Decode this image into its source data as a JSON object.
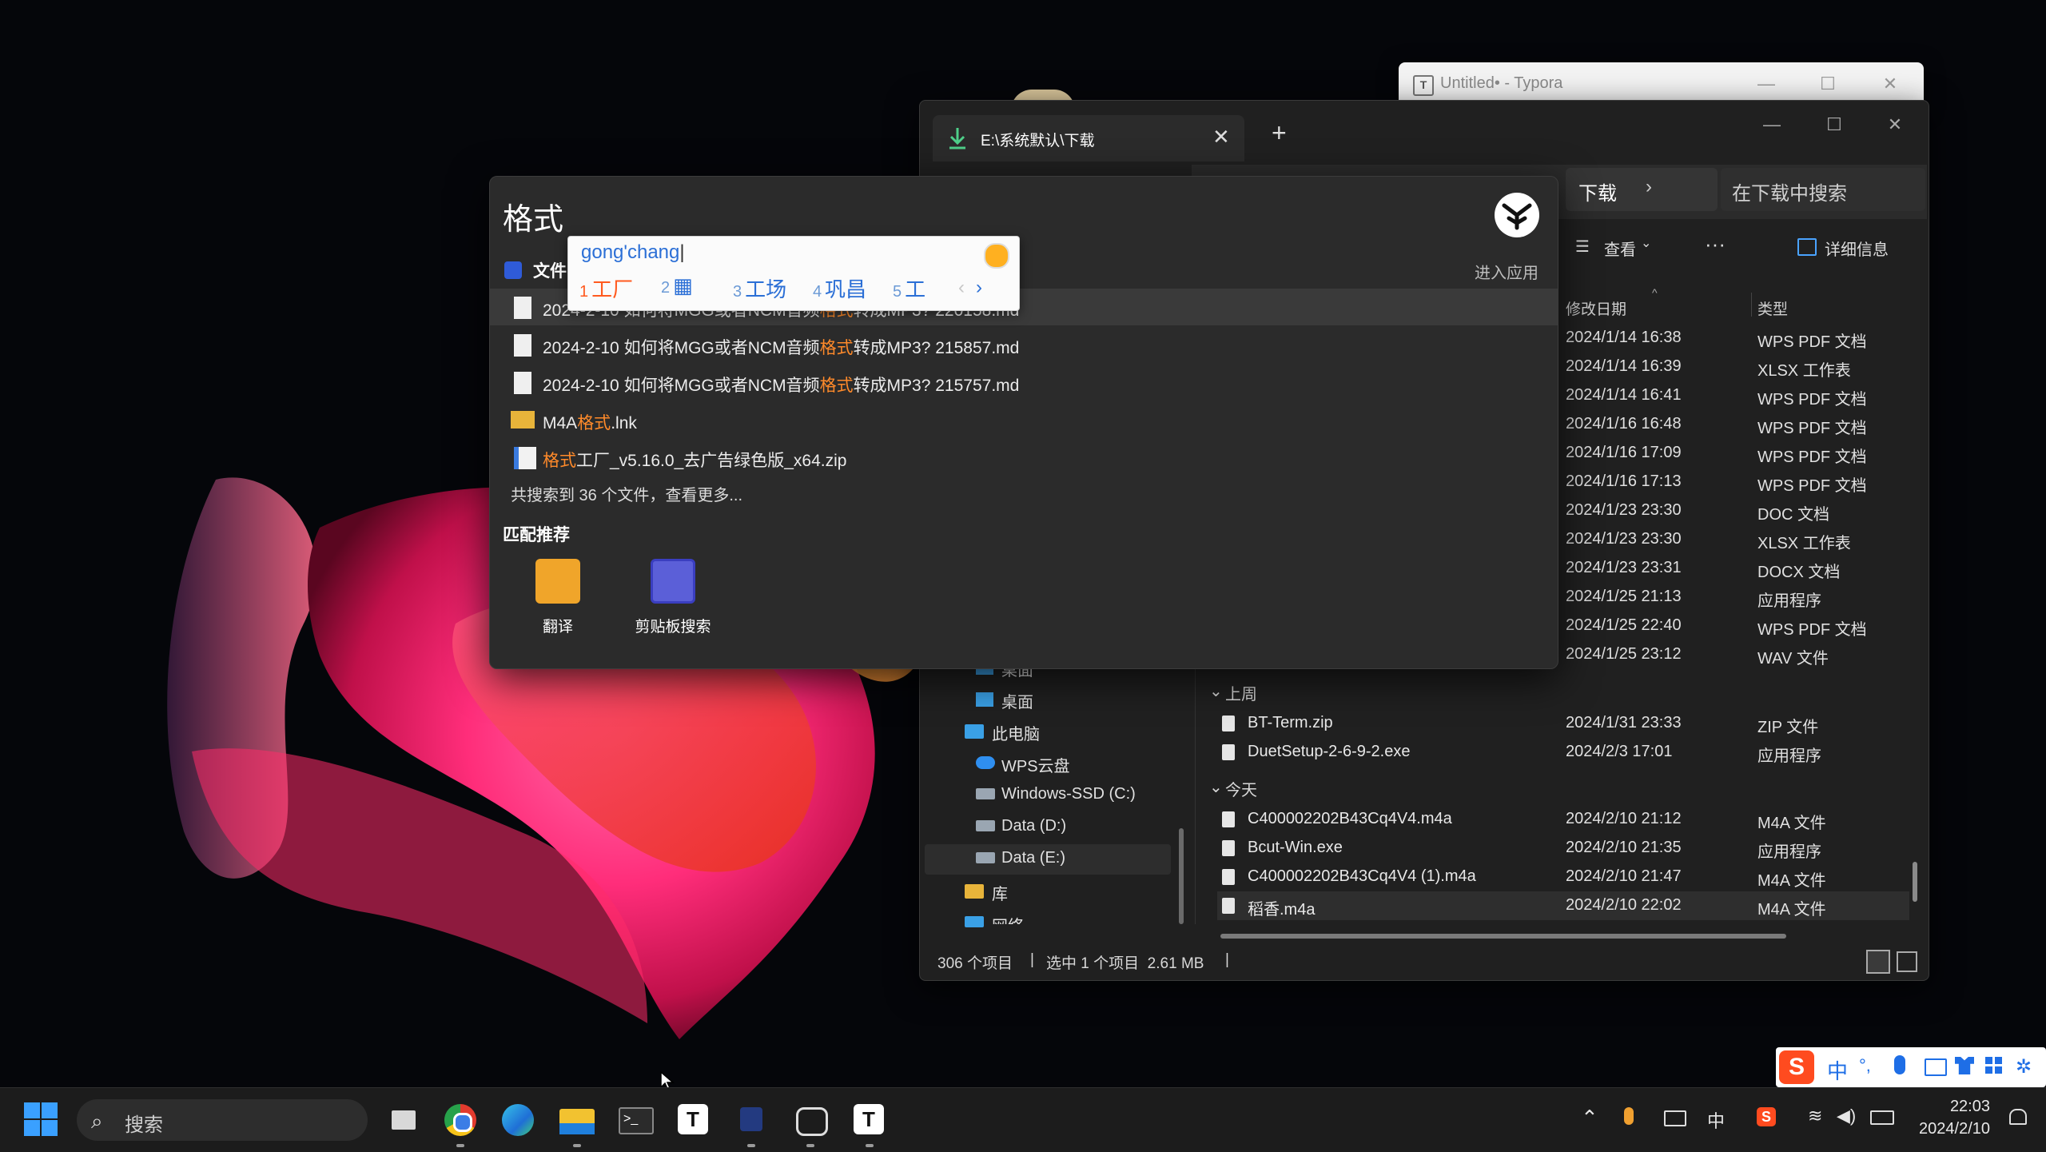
{
  "typora": {
    "title": "Untitled• - Typora",
    "icon": "T"
  },
  "explorer": {
    "tab_label": "E:\\系统默认\\下载",
    "breadcrumb": "下载",
    "search_placeholder": "在下载中搜索",
    "toolbar": {
      "view": "查看",
      "more": "···",
      "details": "详细信息"
    },
    "columns": {
      "date": "修改日期",
      "type": "类型"
    },
    "top_rows": [
      {
        "date": "2024/1/14 16:38",
        "type": "WPS PDF 文档"
      },
      {
        "date": "2024/1/14 16:39",
        "type": "XLSX 工作表"
      },
      {
        "date": "2024/1/14 16:41",
        "type": "WPS PDF 文档"
      },
      {
        "date": "2024/1/16 16:48",
        "type": "WPS PDF 文档"
      },
      {
        "date": "2024/1/16 17:09",
        "type": "WPS PDF 文档"
      },
      {
        "date": "2024/1/16 17:13",
        "type": "WPS PDF 文档"
      },
      {
        "date": "2024/1/23 23:30",
        "type": "DOC 文档"
      },
      {
        "date": "2024/1/23 23:30",
        "type": "XLSX 工作表"
      },
      {
        "date": "2024/1/23 23:31",
        "type": "DOCX 文档"
      },
      {
        "date": "2024/1/25 21:13",
        "type": "应用程序"
      },
      {
        "date": "2024/1/25 22:40",
        "type": "WPS PDF 文档"
      },
      {
        "date": "2024/1/25 23:12",
        "type": "WAV 文件"
      }
    ],
    "group_last_week": "上周",
    "last_week_rows": [
      {
        "name": "BT-Term.zip",
        "date": "2024/1/31 23:33",
        "type": "ZIP 文件"
      },
      {
        "name": "DuetSetup-2-6-9-2.exe",
        "date": "2024/2/3 17:01",
        "type": "应用程序"
      }
    ],
    "group_today": "今天",
    "today_rows": [
      {
        "name": "C400002202B43Cq4V4.m4a",
        "date": "2024/2/10 21:12",
        "type": "M4A 文件"
      },
      {
        "name": "Bcut-Win.exe",
        "date": "2024/2/10 21:35",
        "type": "应用程序"
      },
      {
        "name": "C400002202B43Cq4V4 (1).m4a",
        "date": "2024/2/10 21:47",
        "type": "M4A 文件"
      },
      {
        "name": "稻香.m4a",
        "date": "2024/2/10 22:02",
        "type": "M4A 文件"
      }
    ],
    "nav": [
      "桌面",
      "桌面",
      "此电脑",
      "WPS云盘",
      "Windows-SSD (C:)",
      "Data (D:)",
      "Data (E:)",
      "库",
      "网络"
    ],
    "status": {
      "count": "306 个项目",
      "selected": "选中 1 个项目  2.61 MB"
    }
  },
  "launcher": {
    "query": "格式",
    "section_files": "文件",
    "enter_app": "进入应用",
    "results": [
      {
        "pre": "2024-2-10 如何将MGG或者NCM音频",
        "hl": "格式",
        "post": "转成MP3?  220158.md",
        "kind": "doc"
      },
      {
        "pre": "2024-2-10 如何将MGG或者NCM音频",
        "hl": "格式",
        "post": "转成MP3?  215857.md",
        "kind": "doc"
      },
      {
        "pre": "2024-2-10 如何将MGG或者NCM音频",
        "hl": "格式",
        "post": "转成MP3?  215757.md",
        "kind": "doc"
      },
      {
        "pre": "M4A",
        "hl": "格式",
        "post": ".lnk",
        "kind": "folder"
      },
      {
        "pre": "",
        "hl": "格式",
        "post": "工厂_v5.16.0_去广告绿色版_x64.zip",
        "kind": "zip"
      }
    ],
    "more": "共搜索到 36 个文件，查看更多...",
    "match_title": "匹配推荐",
    "apps": [
      {
        "label": "翻译"
      },
      {
        "label": "剪贴板搜索"
      }
    ]
  },
  "ime": {
    "input": "gong'chang",
    "candidates": [
      {
        "n": "1",
        "text": "工厂"
      },
      {
        "n": "2",
        "text": "▦"
      },
      {
        "n": "3",
        "text": "工场"
      },
      {
        "n": "4",
        "text": "巩昌"
      },
      {
        "n": "5",
        "text": "工"
      }
    ]
  },
  "taskbar": {
    "search": "搜索",
    "ime_mode": "中",
    "time": "22:03",
    "date": "2024/2/10",
    "typora_letter": "T"
  },
  "sogou": {
    "mode": "中"
  }
}
